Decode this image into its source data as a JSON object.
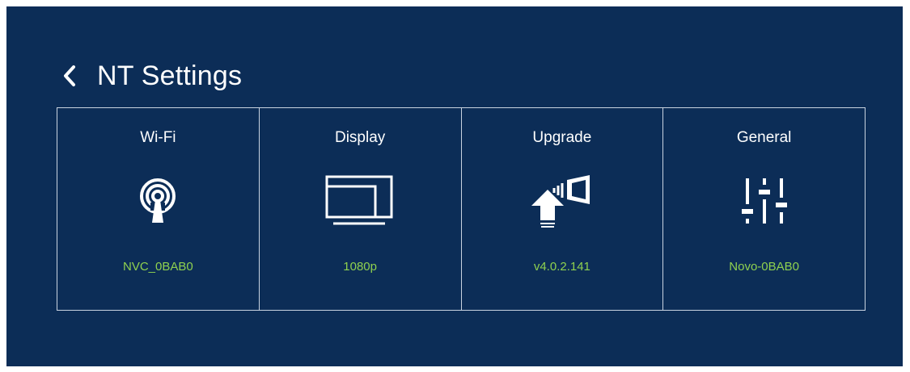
{
  "header": {
    "title": "NT Settings"
  },
  "colors": {
    "background": "#0c2d57",
    "border": "#c9d3e0",
    "value_text": "#8fd14f",
    "text": "#ffffff"
  },
  "cards": [
    {
      "label": "Wi-Fi",
      "value": "NVC_0BAB0",
      "icon": "wifi-antenna-icon"
    },
    {
      "label": "Display",
      "value": "1080p",
      "icon": "display-icon"
    },
    {
      "label": "Upgrade",
      "value": "v4.0.2.141",
      "icon": "upgrade-icon"
    },
    {
      "label": "General",
      "value": "Novo-0BAB0",
      "icon": "sliders-icon"
    }
  ]
}
